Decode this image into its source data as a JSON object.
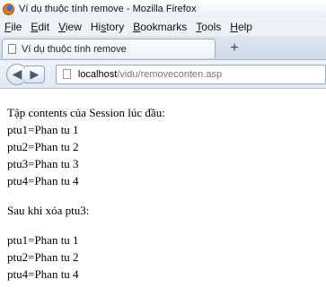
{
  "window": {
    "title": "Ví dụ thuộc tính remove - Mozilla Firefox"
  },
  "menubar": {
    "items": [
      {
        "label": "File",
        "accel": "F",
        "rest": "ile"
      },
      {
        "label": "Edit",
        "accel": "E",
        "rest": "dit"
      },
      {
        "label": "View",
        "accel": "V",
        "rest": "iew"
      },
      {
        "label": "History",
        "pre": "Hi",
        "accel": "s",
        "rest": "tory"
      },
      {
        "label": "Bookmarks",
        "accel": "B",
        "rest": "ookmarks"
      },
      {
        "label": "Tools",
        "accel": "T",
        "rest": "ools"
      },
      {
        "label": "Help",
        "accel": "H",
        "rest": "elp"
      }
    ]
  },
  "tab": {
    "label": "Ví dụ thuộc tính remove",
    "new_tab_symbol": "+"
  },
  "navbar": {
    "back_symbol": "◀",
    "forward_symbol": "▶",
    "url_host": "localhost",
    "url_path": "/vidu/removeconten.asp"
  },
  "content": {
    "heading1": "Tập contents của Session lúc đầu:",
    "initial_items": [
      "ptu1=Phan tu 1",
      "ptu2=Phan tu 2",
      "ptu3=Phan tu 3",
      "ptu4=Phan tu 4"
    ],
    "heading2": "Sau khi xóa ptu3:",
    "after_items": [
      "ptu1=Phan tu 1",
      "ptu2=Phan tu 2",
      "ptu4=Phan tu 4"
    ]
  },
  "icons": {
    "app_icon": "firefox-icon",
    "tab_icon": "page-icon",
    "url_icon": "page-icon"
  }
}
